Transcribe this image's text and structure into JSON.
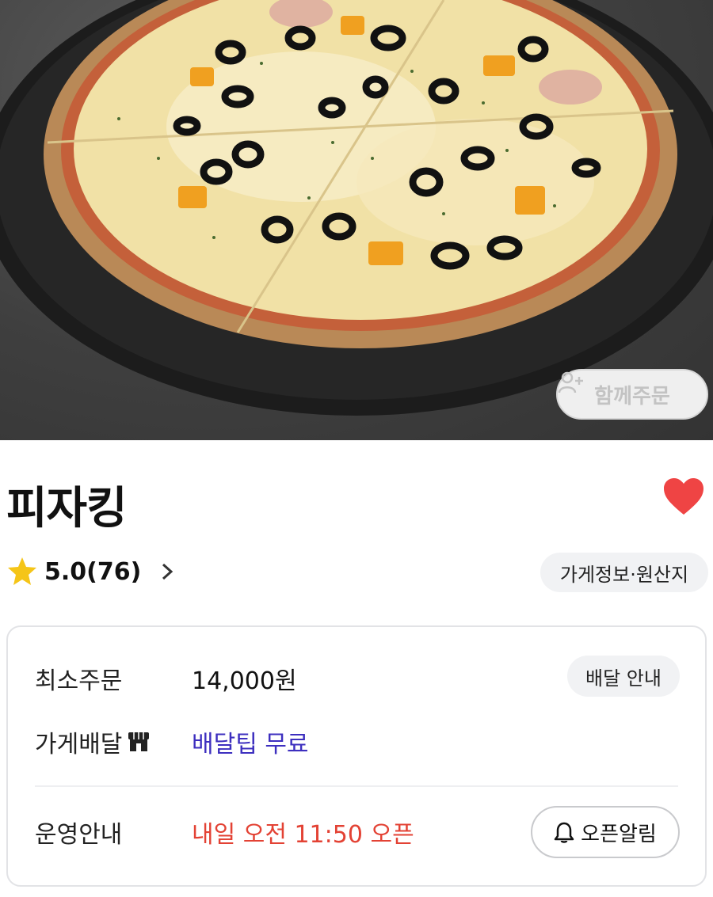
{
  "hero": {
    "image_alt": "pizza-photo",
    "together_button_label": "함께주문"
  },
  "store": {
    "name": "피자킹",
    "favorited": true,
    "rating_text": "5.0(76)",
    "info_chip_label": "가게정보·원산지"
  },
  "info_card": {
    "min_order_label": "최소주문",
    "min_order_value": "14,000원",
    "delivery_guide_label": "배달 안내",
    "delivery_label": "가게배달",
    "delivery_tip_value": "배달팁 무료",
    "hours_label": "운영안내",
    "open_time_value": "내일 오전 11:50 오픈",
    "open_alarm_label": "오픈알림"
  },
  "colors": {
    "accent_red": "#e34234",
    "heart_red": "#ef4444",
    "tip_purple": "#3d2fbf",
    "star_yellow": "#f5c518"
  },
  "icons": [
    "back-icon",
    "share-icon",
    "search-icon",
    "more-icon",
    "add-person-icon",
    "heart-icon",
    "star-icon",
    "chevron-right-icon",
    "store-icon",
    "bell-icon"
  ]
}
